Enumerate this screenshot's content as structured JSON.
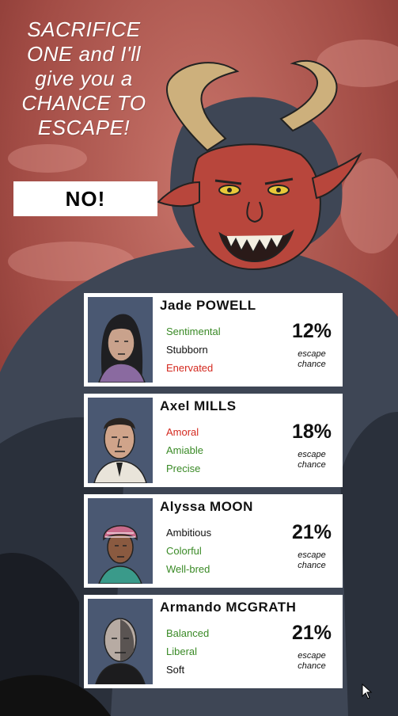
{
  "dialog": {
    "headline_lines": [
      "SACRIFICE",
      "ONE and I'll",
      "give you a",
      "CHANCE TO",
      "ESCAPE!"
    ],
    "no_button_label": "NO!"
  },
  "characters": [
    {
      "name": "Jade POWELL",
      "traits": [
        {
          "label": "Sentimental",
          "tone": "good"
        },
        {
          "label": "Stubborn",
          "tone": "neutral"
        },
        {
          "label": "Enervated",
          "tone": "bad"
        }
      ],
      "escape_chance": "12%",
      "caption_line1": "escape",
      "caption_line2": "chance"
    },
    {
      "name": "Axel MILLS",
      "traits": [
        {
          "label": "Amoral",
          "tone": "bad"
        },
        {
          "label": "Amiable",
          "tone": "good"
        },
        {
          "label": "Precise",
          "tone": "good"
        }
      ],
      "escape_chance": "18%",
      "caption_line1": "escape",
      "caption_line2": "chance"
    },
    {
      "name": "Alyssa MOON",
      "traits": [
        {
          "label": "Ambitious",
          "tone": "neutral"
        },
        {
          "label": "Colorful",
          "tone": "good"
        },
        {
          "label": "Well-bred",
          "tone": "good"
        }
      ],
      "escape_chance": "21%",
      "caption_line1": "escape",
      "caption_line2": "chance"
    },
    {
      "name": "Armando MCGRATH",
      "traits": [
        {
          "label": "Balanced",
          "tone": "good"
        },
        {
          "label": "Liberal",
          "tone": "good"
        },
        {
          "label": "Soft",
          "tone": "neutral"
        }
      ],
      "escape_chance": "21%",
      "caption_line1": "escape",
      "caption_line2": "chance"
    }
  ],
  "colors": {
    "background_red": "#b05a52",
    "demon_skin": "#b8463c",
    "horn": "#cdb07c",
    "fur": "#3e4655",
    "trait_good": "#3a8a26",
    "trait_bad": "#d4291f",
    "portrait_bg": "#4a5872"
  },
  "icons": {
    "portrait": "character-portrait-icon",
    "cursor": "mouse-pointer-icon"
  }
}
